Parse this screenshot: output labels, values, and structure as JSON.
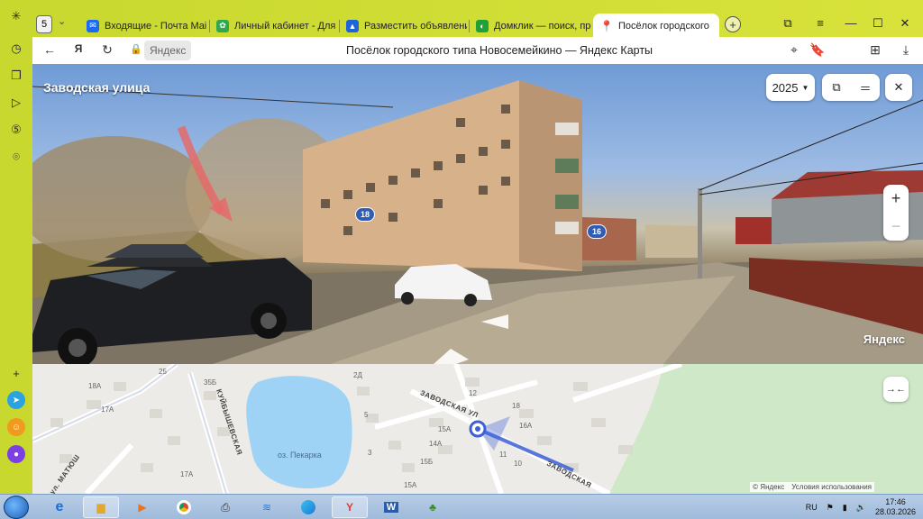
{
  "browser": {
    "tab_count": "5",
    "tabs": [
      {
        "label": "Входящие - Почта Mail",
        "icon": "mail-icon",
        "color": "#1a6af5"
      },
      {
        "label": "Личный кабинет - Для я",
        "icon": "cabinet-icon",
        "color": "#2fa84f"
      },
      {
        "label": "Разместить объявлени",
        "icon": "avito-icon",
        "color": "#1f63d9"
      },
      {
        "label": "Домклик — поиск, прод",
        "icon": "domclick-icon",
        "color": "#21a038"
      },
      {
        "label": "Посёлок городского",
        "icon": "map-pin-icon",
        "color": "#e3342f"
      }
    ],
    "address": {
      "host": "Яндекс",
      "title": "Посёлок городского типа Новосемейкино — Яндекс Карты"
    }
  },
  "panorama": {
    "street": "Заводская улица",
    "year": "2025",
    "brand": "Яндекс",
    "house_badges": [
      "18",
      "16"
    ]
  },
  "map": {
    "lake": "оз. Пекарка",
    "streets": [
      "ЗАВОДСКАЯ УЛ",
      "ЗАВОДСКАЯ",
      "КУЙБЫШЕВСКАЯ",
      "ул. МАТЮШ"
    ],
    "labels": [
      "25",
      "18А",
      "35Б",
      "17А",
      "2Д",
      "12",
      "18",
      "16А",
      "15А",
      "14А",
      "11",
      "10",
      "15Б",
      "15А",
      "17А",
      "5",
      "3"
    ],
    "attribution": [
      "© Яндекс",
      "Условия использования"
    ]
  },
  "taskbar": {
    "lang": "RU",
    "time": "17:46",
    "date": "28.03.2026"
  },
  "colors": {
    "browser_frame": "#d2df35",
    "route": "#3d5fd8",
    "lake": "#9fd3f5",
    "park": "#cfe8c8"
  }
}
